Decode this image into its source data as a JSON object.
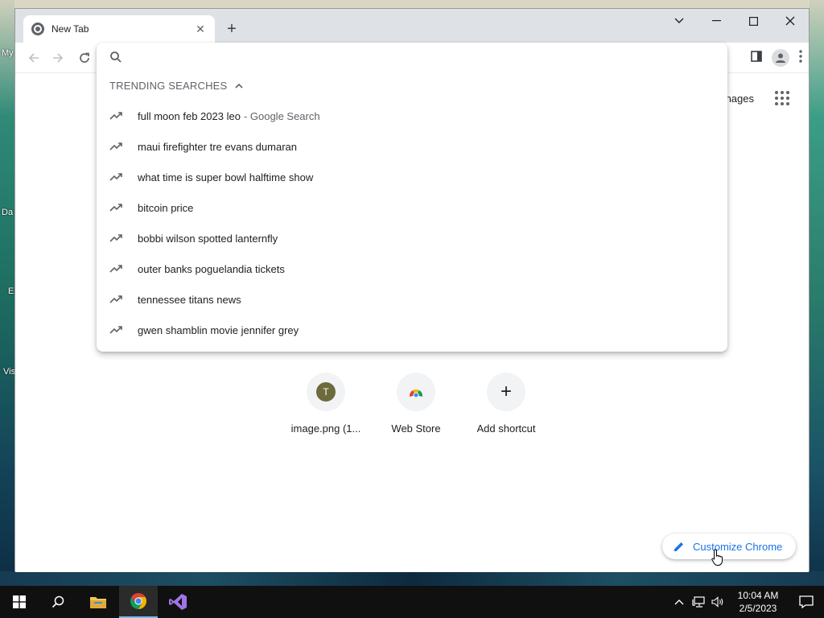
{
  "desktop": {
    "labels": [
      "My",
      "Da",
      "E",
      "Vis"
    ]
  },
  "browser": {
    "tab": {
      "title": "New Tab",
      "close": "✕"
    },
    "new_tab": "+",
    "window_controls": {
      "tab_search": "⌄",
      "minimize": "—",
      "maximize": "☐",
      "close": "✕"
    }
  },
  "omnibox": {
    "value": "",
    "trending_header": "TRENDING SEARCHES",
    "suggestions": [
      {
        "text": "full moon feb 2023 leo",
        "suffix": "- Google Search"
      },
      {
        "text": "maui firefighter tre evans dumaran",
        "suffix": ""
      },
      {
        "text": "what time is super bowl halftime show",
        "suffix": ""
      },
      {
        "text": "bitcoin price",
        "suffix": ""
      },
      {
        "text": "bobbi wilson spotted lanternfly",
        "suffix": ""
      },
      {
        "text": "outer banks poguelandia tickets",
        "suffix": ""
      },
      {
        "text": "tennessee titans news",
        "suffix": ""
      },
      {
        "text": "gwen shamblin movie jennifer grey",
        "suffix": ""
      }
    ]
  },
  "page": {
    "images_link": "nages",
    "shortcuts": [
      {
        "label": "image.png (1...",
        "avatar": "T"
      },
      {
        "label": "Web Store"
      },
      {
        "label": "Add shortcut",
        "icon": "+"
      }
    ],
    "customize_label": "Customize Chrome"
  },
  "taskbar": {
    "time": "10:04 AM",
    "date": "2/5/2023",
    "tray_chevron": "^"
  },
  "colors": {
    "accent": "#1a73e8",
    "taskbar_bg": "#101010",
    "titlebar_bg": "#dee1e6"
  }
}
